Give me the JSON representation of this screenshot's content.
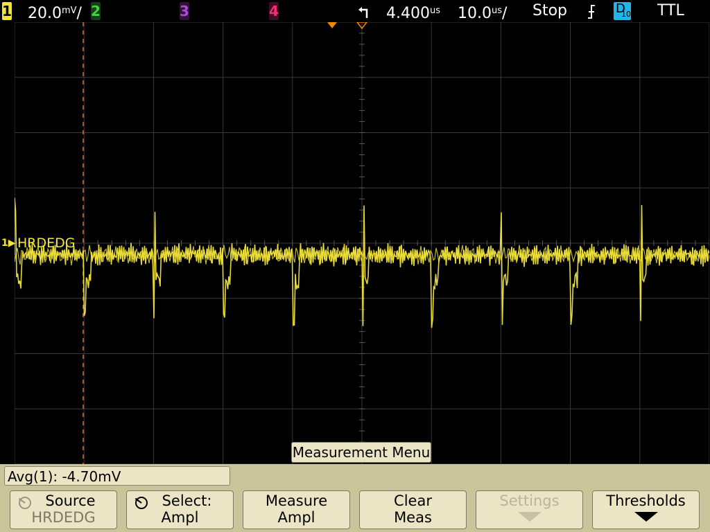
{
  "status": {
    "ch1_label": "1",
    "ch1_scale": "20.0",
    "ch1_scale_unit": "mV",
    "ch2_label": "2",
    "ch3_label": "3",
    "ch4_label": "4",
    "delay_value": "4.400",
    "delay_unit": "us",
    "timebase_value": "10.0",
    "timebase_unit": "us",
    "run_state": "Stop",
    "trigger_slope_icon": "falling-edge-icon",
    "trigger_source": "D10",
    "trigger_source_main": "D",
    "trigger_source_sub": "10",
    "threshold": "TTL"
  },
  "colors": {
    "ch1": "#f2e53a",
    "ch2": "#3fd43f",
    "ch3": "#b348d8",
    "ch4": "#ff2a7a",
    "digital": "#23b5e8",
    "trigger_marker": "#f08a00",
    "grid": "#3a3a3a",
    "cursor": "#e06a28",
    "softkey_bg": "#ece5c5",
    "band_bg": "#c9c49a"
  },
  "trace": {
    "channel_marker": "1",
    "label": "HRDEDG"
  },
  "measurement_menu_title": "Measurement Menu",
  "readout": "Avg(1): -4.70mV",
  "softkeys": [
    {
      "line1": "Source",
      "line2": "HRDEDG",
      "icon": "knob-icon",
      "enabled": true
    },
    {
      "line1": "Select:",
      "line2": "Ampl",
      "icon": "knob-icon",
      "enabled": true
    },
    {
      "line1": "Measure",
      "line2": "Ampl",
      "enabled": true
    },
    {
      "line1": "Clear",
      "line2": "Meas",
      "enabled": true
    },
    {
      "line1": "Settings",
      "line2": "",
      "icon": "submenu-arrow-icon",
      "enabled": false
    },
    {
      "line1": "Thresholds",
      "line2": "",
      "icon": "submenu-arrow-icon",
      "enabled": true
    }
  ]
}
